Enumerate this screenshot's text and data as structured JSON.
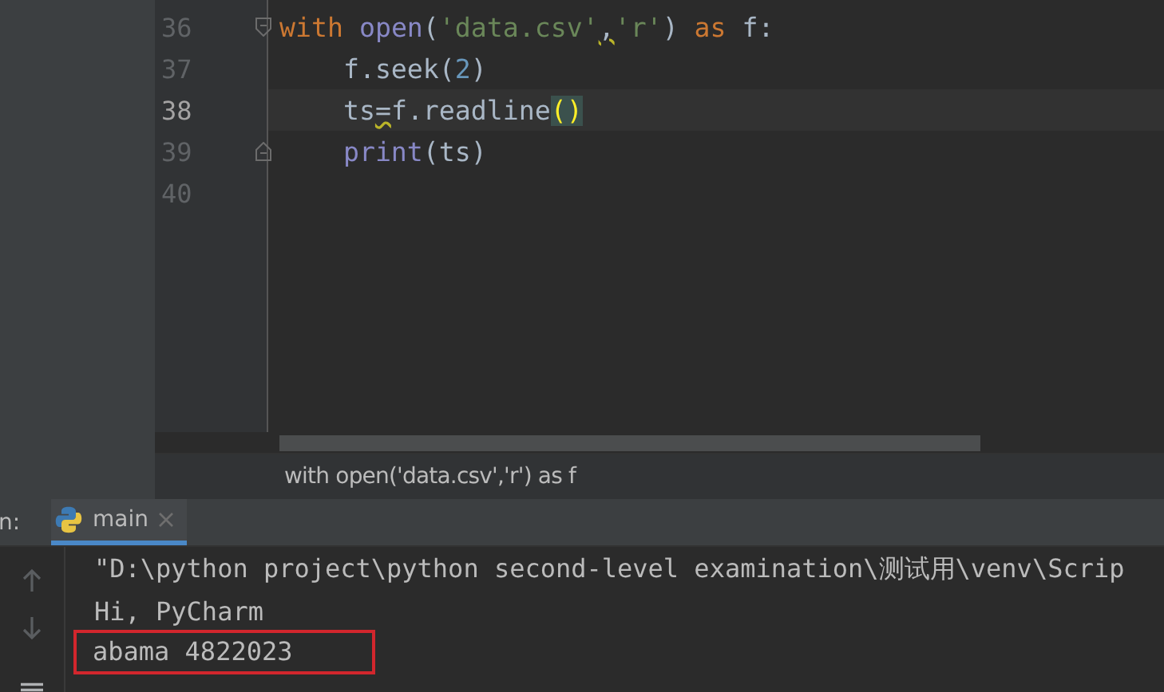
{
  "editor": {
    "lines": [
      {
        "number": "36",
        "current": false,
        "fold_start": true,
        "tokens": [
          {
            "kind": "keyword",
            "text": "with"
          },
          {
            "kind": "builtin",
            "text": " open"
          },
          {
            "kind": "plain",
            "text": "("
          },
          {
            "kind": "string",
            "text": "'data.csv'"
          },
          {
            "kind": "warning",
            "text": ","
          },
          {
            "kind": "string",
            "text": "'r'"
          },
          {
            "kind": "plain",
            "text": ") "
          },
          {
            "kind": "keyword",
            "text": "as"
          },
          {
            "kind": "plain",
            "text": " f:"
          }
        ]
      },
      {
        "number": "37",
        "current": false,
        "tokens": [
          {
            "kind": "plain",
            "text": "    f.seek("
          },
          {
            "kind": "number",
            "text": "2"
          },
          {
            "kind": "plain",
            "text": ")"
          }
        ]
      },
      {
        "number": "38",
        "current": true,
        "tokens": [
          {
            "kind": "plain",
            "text": "    ts"
          },
          {
            "kind": "warning",
            "text": "="
          },
          {
            "kind": "plain",
            "text": "f.readline"
          },
          {
            "kind": "brace",
            "text": "()"
          }
        ]
      },
      {
        "number": "39",
        "current": false,
        "fold_end": true,
        "tokens": [
          {
            "kind": "builtin",
            "text": "    print"
          },
          {
            "kind": "plain",
            "text": "(ts)"
          }
        ]
      },
      {
        "number": "40",
        "current": false
      }
    ]
  },
  "breadcrumb": "with open('data.csv','r') as f",
  "run_panel": {
    "label": "n:",
    "tabs": [
      {
        "label": "main",
        "selected": true
      }
    ],
    "console": [
      {
        "text": "\"D:\\python project\\python second-level examination\\测试用\\venv\\Scrip",
        "highlighted": false
      },
      {
        "text": "Hi, PyCharm",
        "highlighted": false
      },
      {
        "text": "abama 4822023",
        "highlighted": true
      }
    ]
  }
}
